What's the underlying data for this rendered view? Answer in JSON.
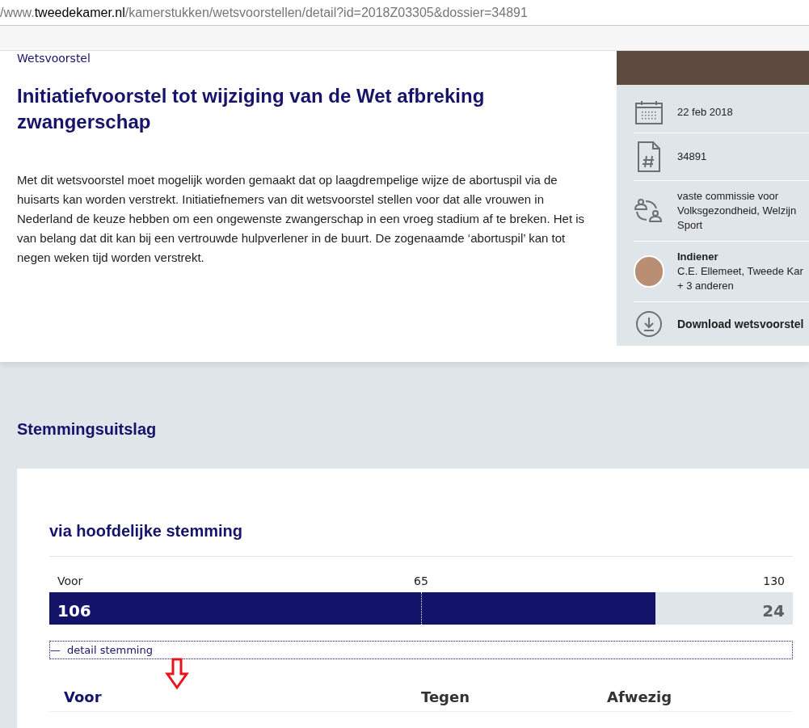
{
  "address_bar": {
    "prefix": "/www.",
    "domain": "tweedekamer.nl",
    "path": "/kamerstukken/wetsvoorstellen/detail?id=2018Z03305&dossier=34891"
  },
  "document": {
    "type_label": "Wetsvoorstel",
    "title": "Initiatiefvoorstel tot wijziging van de Wet afbreking zwangerschap",
    "summary": "Met dit wetsvoorstel moet mogelijk worden gemaakt dat op laagdrempelige wijze de abortuspil via de huisarts kan worden verstrekt. Initiatiefnemers van dit wetsvoorstel stellen voor dat alle vrouwen in Nederland de keuze hebben om een ongewenste zwangerschap in een vroeg stadium af te breken. Het is van belang dat dit kan bij een vertrouwde hulpverlener in de buurt. De zogenaamde ‘abortuspil’ kan tot negen weken tijd worden verstrekt."
  },
  "sidebar": {
    "items": [
      {
        "kind": "date",
        "lines": [
          "22 feb 2018"
        ]
      },
      {
        "kind": "number",
        "lines": [
          "34891"
        ]
      },
      {
        "kind": "committee",
        "lines": [
          "vaste commissie voor",
          "Volksgezondheid, Welzijn",
          "Sport"
        ]
      },
      {
        "kind": "submitter",
        "heading": "Indiener",
        "lines": [
          "C.E. Ellemeet, Tweede Kar",
          "+ 3 anderen"
        ]
      },
      {
        "kind": "download",
        "lines": [
          "Download wetsvoorstel"
        ]
      }
    ]
  },
  "vote": {
    "section_title": "Stemmingsuitslag",
    "method": "via hoofdelijke stemming",
    "bar_label": "Voor",
    "midpoint": "65",
    "total": "130",
    "level": 0.815,
    "for_count": "106",
    "against_count": "24",
    "detail_toggle": {
      "icon": "—",
      "label": "detail stemming",
      "expanded": true
    },
    "columns": [
      {
        "label": "Voor",
        "selected": true
      },
      {
        "label": "Tegen",
        "selected": false
      },
      {
        "label": "Afwezig",
        "selected": false
      }
    ]
  }
}
